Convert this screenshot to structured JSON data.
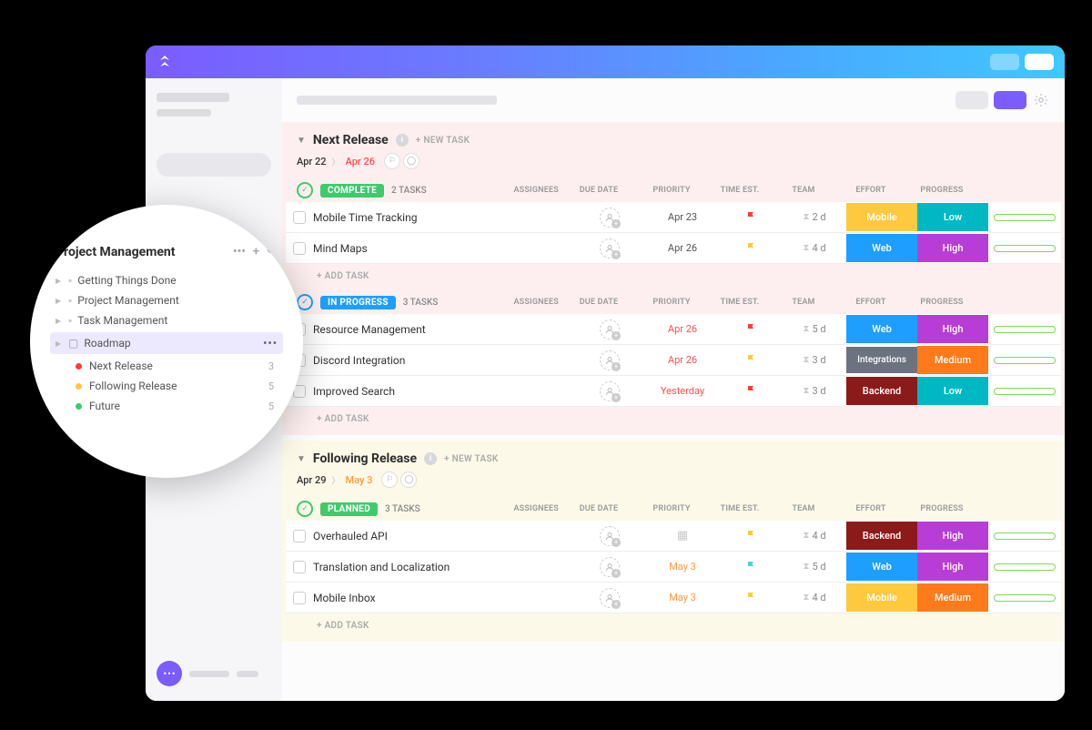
{
  "popout": {
    "title": "Project Management",
    "items": [
      {
        "label": "Getting Things Done"
      },
      {
        "label": "Project Management"
      },
      {
        "label": "Task Management"
      },
      {
        "label": "Roadmap",
        "selected": true
      }
    ],
    "subitems": [
      {
        "dot": "red",
        "label": "Next Release",
        "count": "3"
      },
      {
        "dot": "yellow",
        "label": "Following Release",
        "count": "5"
      },
      {
        "dot": "green",
        "label": "Future",
        "count": "5"
      }
    ]
  },
  "columns": {
    "assignees": "ASSIGNEES",
    "due_date": "DUE DATE",
    "priority": "PRIORITY",
    "time_est": "TIME EST.",
    "team": "TEAM",
    "effort": "EFFORT",
    "progress": "PROGRESS"
  },
  "groups": [
    {
      "title": "Next Release",
      "new_task": "+ NEW TASK",
      "date_start": "Apr 22",
      "date_end": "Apr 26",
      "date_end_class": "red",
      "bg": "red-bg",
      "sections": [
        {
          "status": "COMPLETE",
          "status_class": "complete",
          "status_icon": "green",
          "count": "2 TASKS",
          "tasks": [
            {
              "name": "Mobile Time Tracking",
              "due": "Apr 23",
              "due_class": "",
              "priority_class": "red",
              "time": "2 d",
              "team": "Mobile",
              "team_class": "mobile",
              "effort": "Low",
              "effort_class": "low"
            },
            {
              "name": "Mind Maps",
              "due": "Apr 26",
              "due_class": "",
              "priority_class": "yellow",
              "time": "4 d",
              "team": "Web",
              "team_class": "web",
              "effort": "High",
              "effort_class": "high"
            }
          ],
          "add_task": "+ ADD TASK"
        },
        {
          "status": "IN PROGRESS",
          "status_class": "inprogress",
          "status_icon": "blue",
          "count": "3 TASKS",
          "tasks": [
            {
              "name": "Resource Management",
              "due": "Apr 26",
              "due_class": "red",
              "priority_class": "red",
              "time": "5 d",
              "team": "Web",
              "team_class": "web",
              "effort": "High",
              "effort_class": "high"
            },
            {
              "name": "Discord Integration",
              "due": "Apr 26",
              "due_class": "red",
              "priority_class": "yellow",
              "time": "3 d",
              "team": "Integrations",
              "team_class": "integrations",
              "effort": "Medium",
              "effort_class": "medium"
            },
            {
              "name": "Improved Search",
              "due": "Yesterday",
              "due_class": "red",
              "priority_class": "red",
              "time": "3 d",
              "team": "Backend",
              "team_class": "backend",
              "effort": "Low",
              "effort_class": "low"
            }
          ],
          "add_task": "+ ADD TASK"
        }
      ]
    },
    {
      "title": "Following Release",
      "new_task": "+ NEW TASK",
      "date_start": "Apr 29",
      "date_end": "May 3",
      "date_end_class": "orange",
      "bg": "yellow-bg",
      "sections": [
        {
          "status": "PLANNED",
          "status_class": "planned",
          "status_icon": "green",
          "count": "3 TASKS",
          "tasks": [
            {
              "name": "Overhauled API",
              "due": "",
              "due_class": "cal",
              "priority_class": "yellow",
              "time": "4 d",
              "team": "Backend",
              "team_class": "backend",
              "effort": "High",
              "effort_class": "high"
            },
            {
              "name": "Translation and Localization",
              "due": "May 3",
              "due_class": "orange",
              "priority_class": "teal",
              "time": "5 d",
              "team": "Web",
              "team_class": "web",
              "effort": "High",
              "effort_class": "high"
            },
            {
              "name": "Mobile Inbox",
              "due": "May 3",
              "due_class": "orange",
              "priority_class": "yellow",
              "time": "4 d",
              "team": "Mobile",
              "team_class": "mobile",
              "effort": "Medium",
              "effort_class": "medium"
            }
          ],
          "add_task": "+ ADD TASK"
        }
      ]
    }
  ]
}
